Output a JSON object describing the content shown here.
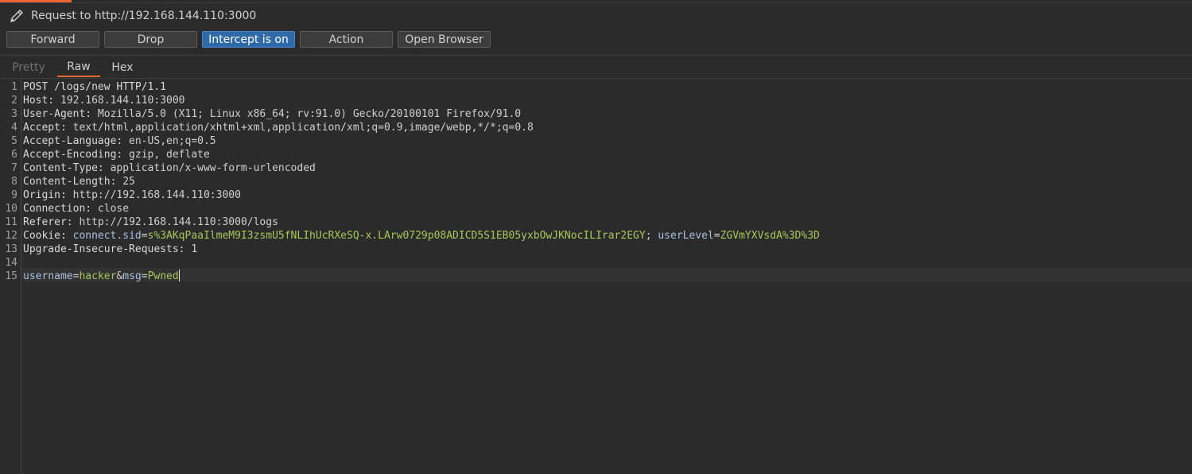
{
  "titlebar": {
    "icon": "pencil-icon",
    "text": "Request to http://192.168.144.110:3000"
  },
  "toolbar": {
    "forward": "Forward",
    "drop": "Drop",
    "intercept": "Intercept is on",
    "action": "Action",
    "open_browser": "Open Browser"
  },
  "tabs": {
    "pretty": "Pretty",
    "raw": "Raw",
    "hex": "Hex",
    "active": "Raw"
  },
  "request": {
    "l1": "POST /logs/new HTTP/1.1",
    "l2k": "Host:",
    "l2v": " 192.168.144.110:3000",
    "l3k": "User-Agent:",
    "l3v": " Mozilla/5.0 (X11; Linux x86_64; rv:91.0) Gecko/20100101 Firefox/91.0",
    "l4k": "Accept:",
    "l4v": " text/html,application/xhtml+xml,application/xml;q=0.9,image/webp,*/*;q=0.8",
    "l5k": "Accept-Language:",
    "l5v": " en-US,en;q=0.5",
    "l6k": "Accept-Encoding:",
    "l6v": " gzip, deflate",
    "l7k": "Content-Type:",
    "l7v": " application/x-www-form-urlencoded",
    "l8k": "Content-Length:",
    "l8v": " 25",
    "l9k": "Origin:",
    "l9v": " http://192.168.144.110:3000",
    "l10k": "Connection:",
    "l10v": " close",
    "l11k": "Referer:",
    "l11v": " http://192.168.144.110:3000/logs",
    "l12k": "Cookie:",
    "cookie1_name": "connect.sid",
    "cookie1_value": "s%3AKqPaaIlmeM9I3zsmU5fNLIhUcRXeSQ-x.LArw0729p08ADICD5S1EB05yxbOwJKNocILIrar2EGY",
    "cookie2_name": "userLevel",
    "cookie2_value": "ZGVmYXVsdA%3D%3D",
    "l13k": "Upgrade-Insecure-Requests:",
    "l13v": " 1",
    "body_k1": "username",
    "body_v1": "hacker",
    "body_k2": "msg",
    "body_v2": "Pwned"
  },
  "colors": {
    "accent": "#e8662f",
    "intercept_on": "#2f69a8",
    "value_green": "#a8c65a",
    "param_blue": "#a9c0e0"
  }
}
